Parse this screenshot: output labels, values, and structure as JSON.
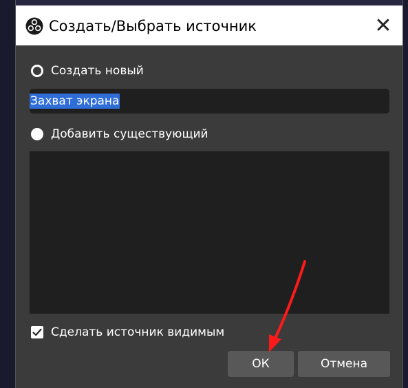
{
  "dialog": {
    "title": "Создать/Выбрать источник",
    "close_icon": "close-icon"
  },
  "create_new": {
    "label": "Создать новый",
    "selected": false
  },
  "name_field": {
    "value": "Захват экрана"
  },
  "add_existing": {
    "label": "Добавить существующий",
    "selected": true
  },
  "existing_sources": [],
  "visible_checkbox": {
    "label": "Сделать источник видимым",
    "checked": true
  },
  "buttons": {
    "ok_label": "ОК",
    "cancel_label": "Отмена"
  },
  "colors": {
    "dialog_bg": "#3b3b3b",
    "field_bg": "#1f1f1f",
    "selection": "#2f6ed8",
    "button_bg": "#585858",
    "annotation_arrow": "#ff1a1a"
  }
}
